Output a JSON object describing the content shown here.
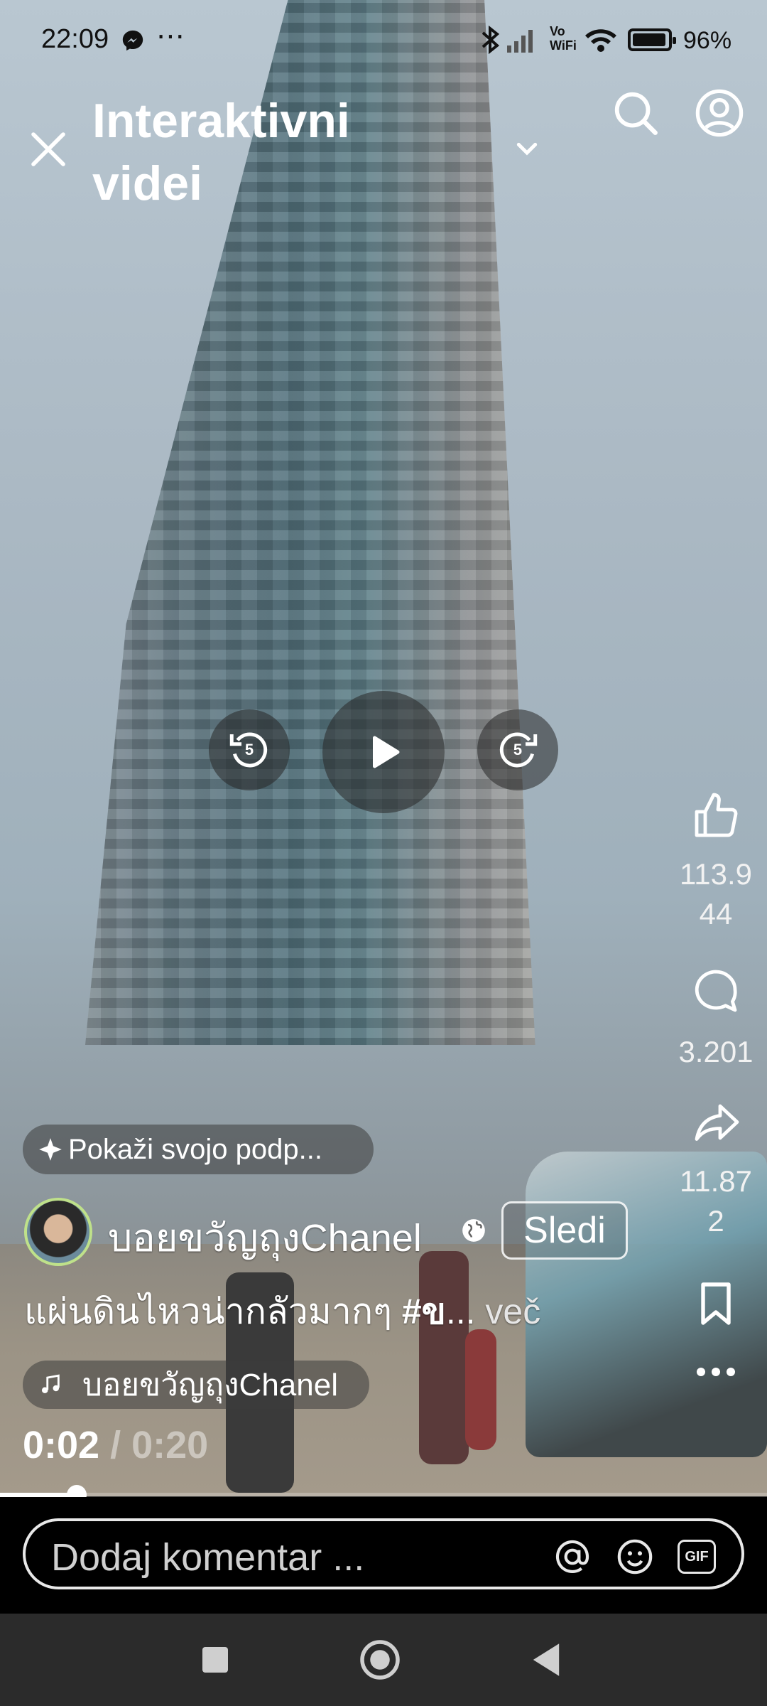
{
  "status_bar": {
    "time": "22:09",
    "messenger_icon": "messenger-icon",
    "more_icon": "⋯",
    "bluetooth_icon": "bluetooth-icon",
    "signal_icon": "signal-icon",
    "vowifi_label": "Vo\nWiFi",
    "wifi_icon": "wifi-icon",
    "battery_percent": "96%"
  },
  "header": {
    "title": "Interaktivni videi",
    "close_icon": "close-icon",
    "dropdown_icon": "chevron-down-icon",
    "search_icon": "search-icon",
    "profile_icon": "profile-icon"
  },
  "playback": {
    "rewind_label": "5",
    "forward_label": "5",
    "play_icon": "play-icon"
  },
  "actions": {
    "likes": "113.9\n44",
    "comments": "3.201",
    "shares": "11.87\n2",
    "save_icon": "bookmark-icon",
    "more_icon": "more-icon"
  },
  "post": {
    "sticker_prompt": "Pokaži svojo podp...",
    "channel_name": "บอยขวัญถุงChanel",
    "follow_label": "Sledi",
    "caption_text": "แผ่นดินไหวน่ากลัวมากๆ ",
    "caption_tag": "#ข",
    "caption_ellipsis": "... ",
    "caption_more": "več",
    "music_label": "บอยขวัญถุงChanel",
    "current_time": "0:02",
    "time_separator": " / ",
    "duration": "0:20",
    "progress_fraction": 0.1
  },
  "comment_bar": {
    "placeholder": "Dodaj komentar ...",
    "mention_icon": "at-icon",
    "emoji_icon": "emoji-icon",
    "gif_label": "GIF"
  },
  "nav": {
    "recents_icon": "square-icon",
    "home_icon": "circle-icon",
    "back_icon": "triangle-back-icon"
  },
  "colors": {
    "accent_avatar_ring": "#bfe18a",
    "navbar_bg": "#2b2b2b"
  }
}
